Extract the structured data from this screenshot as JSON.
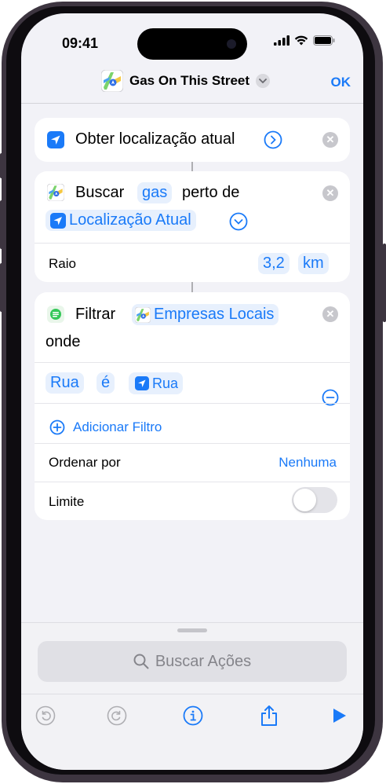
{
  "status_bar": {
    "time": "09:41"
  },
  "header": {
    "title": "Gas On This Street",
    "ok_label": "OK"
  },
  "action1": {
    "label": "Obter localização atual"
  },
  "action2": {
    "verb": "Buscar",
    "query_token": "gas",
    "near_label": "perto de",
    "location_token": "Localização Atual",
    "radius_label": "Raio",
    "radius_value": "3,2",
    "radius_unit": "km"
  },
  "action3": {
    "verb": "Filtrar",
    "source_token": "Empresas Locais",
    "where_label": "onde",
    "filter_field": "Rua",
    "filter_operator": "é",
    "filter_value": "Rua",
    "add_filter_label": "Adicionar Filtro",
    "sort_label": "Ordenar por",
    "sort_value": "Nenhuma",
    "limit_label": "Limite",
    "limit_enabled": false
  },
  "bottom_sheet": {
    "search_placeholder": "Buscar Ações"
  },
  "colors": {
    "accent": "#1a7af8",
    "background": "#f2f2f7"
  }
}
